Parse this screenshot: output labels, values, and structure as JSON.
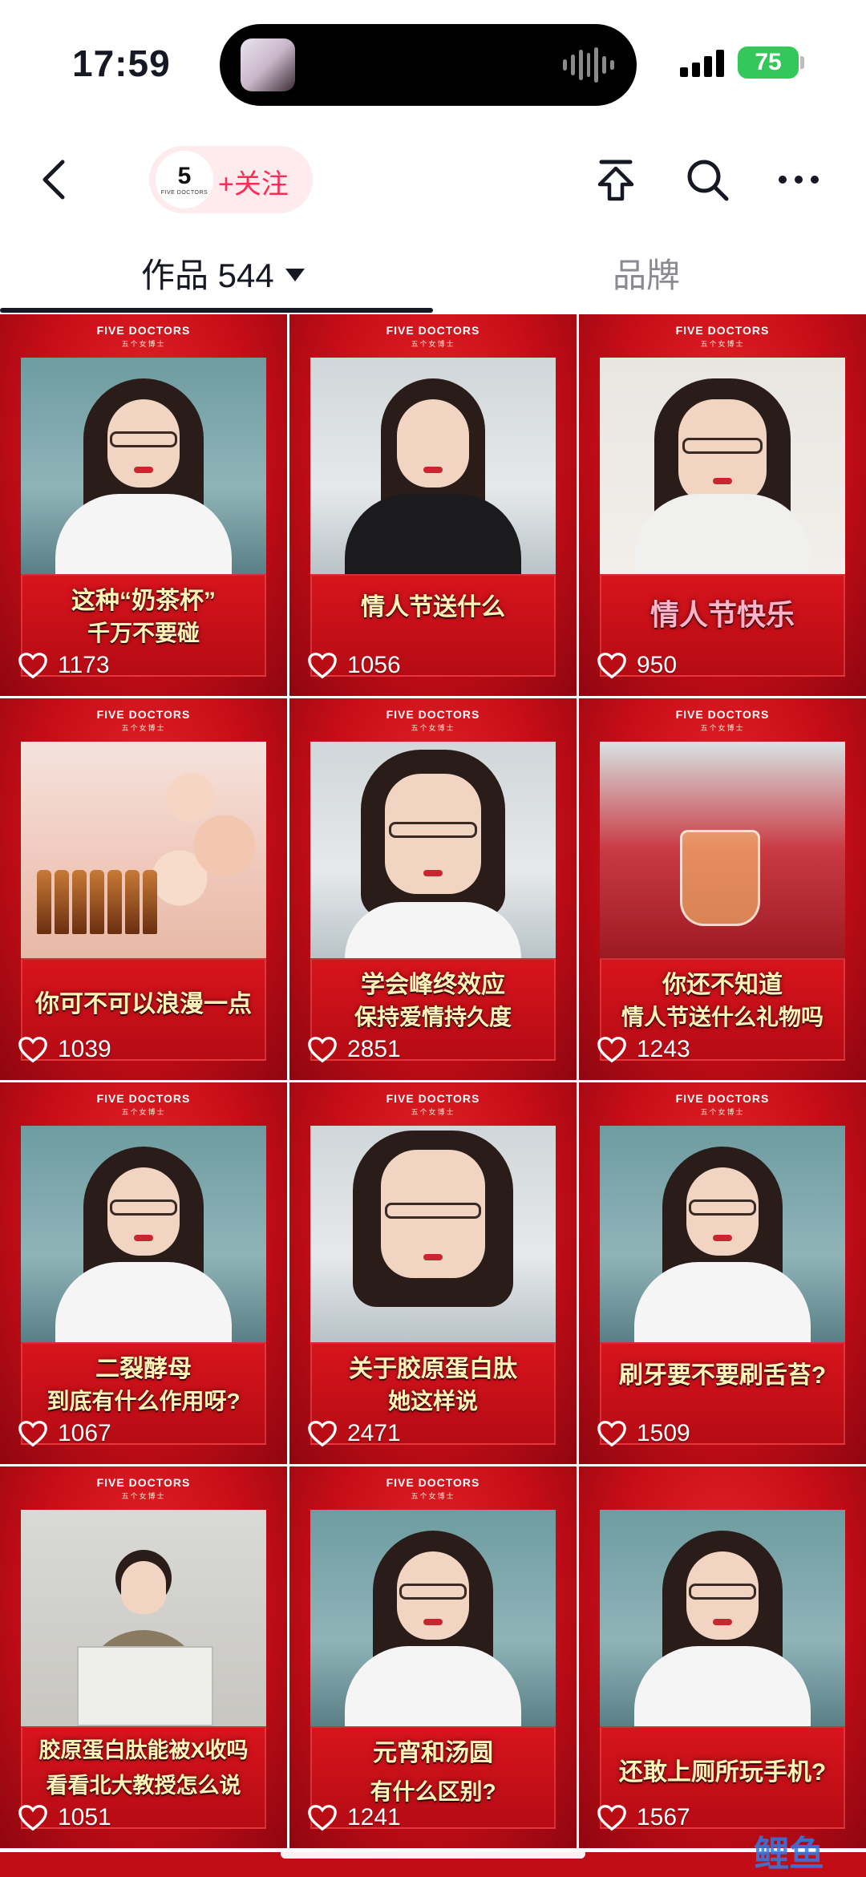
{
  "status_bar": {
    "time": "17:59",
    "battery": "75"
  },
  "header": {
    "avatar": {
      "number": "5",
      "brand": "FIVE DOCTORS"
    },
    "follow_label": "+关注",
    "icons": [
      "back-icon",
      "share-icon",
      "search-icon",
      "more-icon"
    ]
  },
  "tabs": [
    {
      "label": "作品 544",
      "active": true
    },
    {
      "label": "品牌",
      "active": false
    }
  ],
  "card_brand": {
    "name": "FIVE DOCTORS",
    "sub": "五个女博士"
  },
  "videos": [
    {
      "line1": "这种“奶茶杯”",
      "line2": "千万不要碰",
      "likes": "1173"
    },
    {
      "line1": "情人节送什么",
      "line2": "",
      "likes": "1056"
    },
    {
      "line1": "情人节快乐",
      "line2": "",
      "likes": "950"
    },
    {
      "line1": "你可不可以浪漫一点",
      "line2": "",
      "likes": "1039"
    },
    {
      "line1": "学会峰终效应",
      "line2": "保持爱情持久度",
      "likes": "2851"
    },
    {
      "line1": "你还不知道",
      "line2": "情人节送什么礼物吗",
      "likes": "1243"
    },
    {
      "line1": "二裂酵母",
      "line2": "到底有什么作用呀?",
      "likes": "1067"
    },
    {
      "line1": "关于胶原蛋白肽",
      "line2": "她这样说",
      "likes": "2471"
    },
    {
      "line1": "刷牙要不要刷舌苔?",
      "line2": "",
      "likes": "1509"
    },
    {
      "line1": "胶原蛋白肽能被X收吗",
      "line2": "看看北大教授怎么说",
      "likes": "1051"
    },
    {
      "line1": "元宵和汤圆",
      "line2": "有什么区别?",
      "likes": "1241"
    },
    {
      "line1": "还敢上厕所玩手机?",
      "line2": "",
      "likes": "1567"
    }
  ],
  "watermark": "鲤鱼",
  "colors": {
    "accent": "#fe2c55",
    "card_red": "#c70d17",
    "caption_yellow": "#fff4b8"
  }
}
